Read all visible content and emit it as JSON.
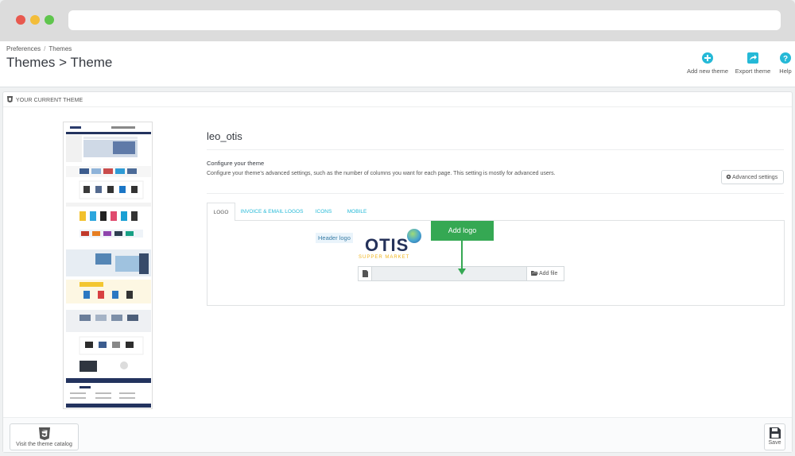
{
  "breadcrumb": {
    "item1": "Preferences",
    "separator": "/",
    "item2": "Themes"
  },
  "page_title": "Themes > Theme",
  "toolbar": {
    "add_new_theme": "Add new theme",
    "export_theme": "Export theme",
    "help": "Help"
  },
  "panel": {
    "heading": "YOUR CURRENT THEME",
    "theme_name": "leo_otis",
    "configure_title": "Configure your theme",
    "configure_desc": "Configure your theme's advanced settings, such as the number of columns you want for each page. This setting is mostly for advanced users.",
    "advanced_settings": "Advanced settings",
    "tabs": [
      "LOGO",
      "INVOICE & EMAIL LOGOS",
      "ICONS",
      "MOBILE"
    ],
    "header_logo_label": "Header logo",
    "logo_text": "OTIS",
    "logo_subtext": "SUPPER MARKET",
    "add_file": "Add file",
    "callout": "Add logo"
  },
  "footer": {
    "catalog_button": "Visit the theme catalog",
    "save_button": "Save"
  },
  "colors": {
    "accent": "#25b9d7",
    "callout": "#35a853",
    "logo_navy": "#25325a",
    "logo_yellow": "#f0b41b"
  }
}
